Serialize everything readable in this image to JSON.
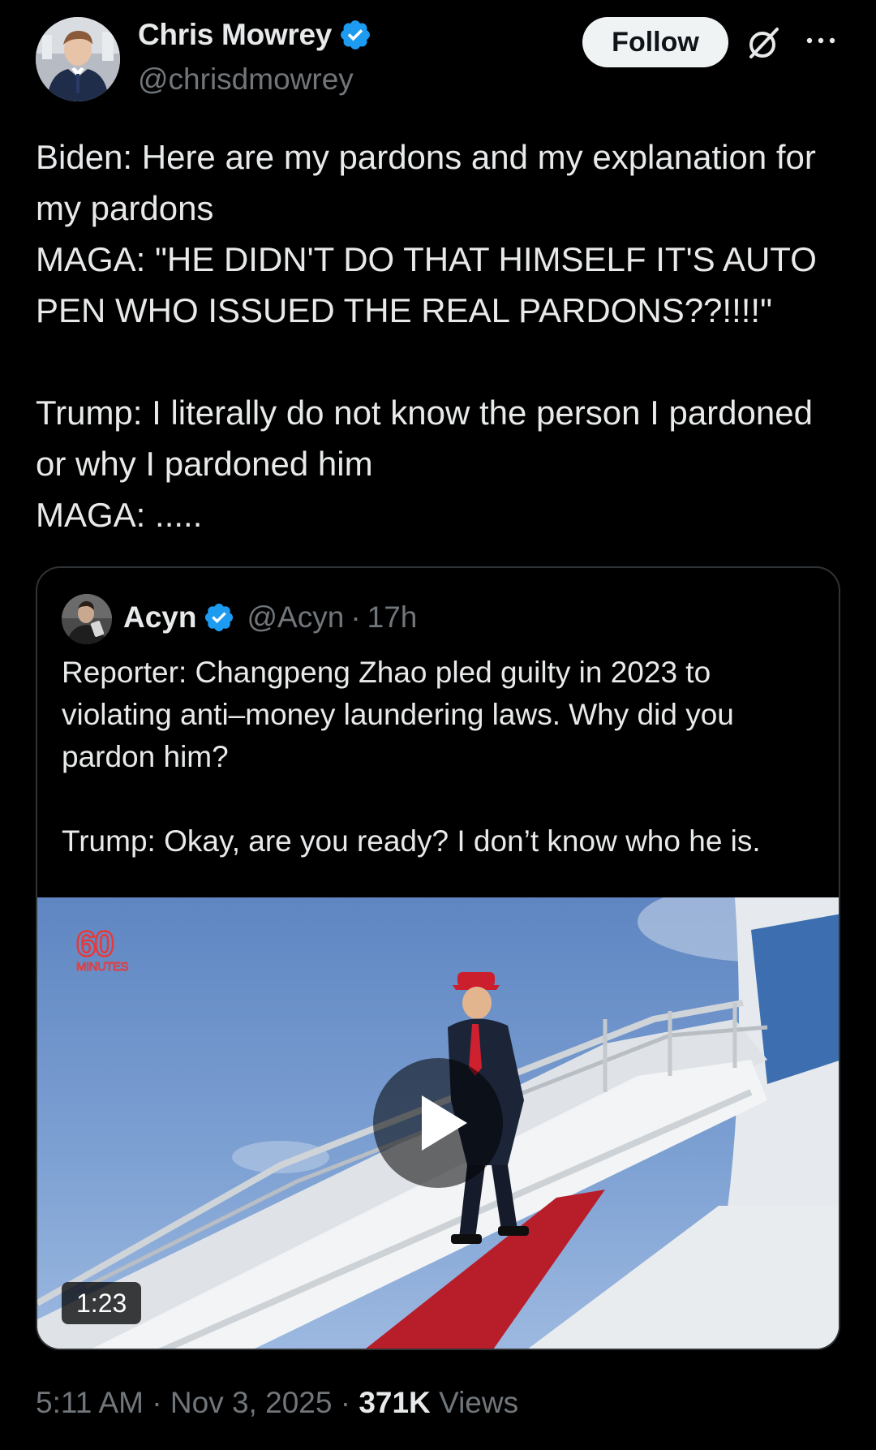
{
  "author": {
    "name": "Chris Mowrey",
    "handle": "@chrisdmowrey",
    "verified": true
  },
  "header": {
    "follow_label": "Follow",
    "grok_icon": "grok-icon",
    "more_icon": "more-icon"
  },
  "tweet": {
    "text": "Biden: Here are my pardons and my explanation for my pardons\nMAGA: \"HE DIDN'T DO THAT HIMSELF IT'S AUTO PEN WHO ISSUED THE REAL PARDONS??!!!!\"\n\nTrump: I literally do not know the person I pardoned or why I pardoned him\nMAGA: ....."
  },
  "quote": {
    "name": "Acyn",
    "handle": "@Acyn",
    "separator": "·",
    "time": "17h",
    "verified": true,
    "text": "Reporter: Changpeng Zhao pled guilty in 2023 to violating anti–money laundering laws. Why did you pardon him?\n\nTrump: Okay, are you ready? I don’t know who he is.",
    "video": {
      "duration": "1:23",
      "watermark": "60 MINUTES",
      "play_icon": "play-icon"
    }
  },
  "meta": {
    "time": "5:11 AM",
    "separator": " · ",
    "date": "Nov 3, 2025",
    "views_count": "371K",
    "views_label": "Views"
  },
  "colors": {
    "background": "#000000",
    "text_primary": "#e7e9ea",
    "text_secondary": "#71767b",
    "verified_blue": "#1d9bf0",
    "border": "#2f3336",
    "follow_bg": "#eff3f4"
  }
}
